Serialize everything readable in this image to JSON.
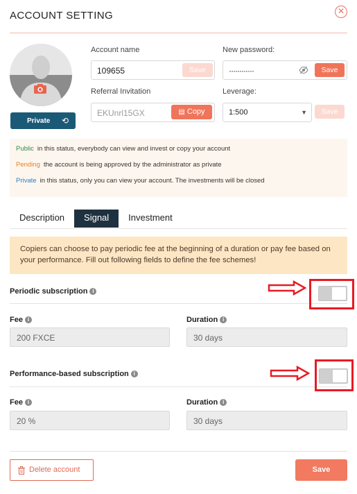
{
  "header": {
    "title": "ACCOUNT SETTING"
  },
  "profile": {
    "privacy_button": "Private"
  },
  "account_name": {
    "label": "Account name",
    "value": "109655",
    "save_label": "Save"
  },
  "new_password": {
    "label": "New password:",
    "value": "············",
    "save_label": "Save"
  },
  "referral": {
    "label": "Referral Invitation",
    "value": "EKUnrl15GX",
    "copy_label": "Copy"
  },
  "leverage": {
    "label": "Leverage:",
    "value": "1:500",
    "save_label": "Save"
  },
  "legend": [
    {
      "key": "Public",
      "text": "in this status, everybody can view and invest or copy your account"
    },
    {
      "key": "Pending",
      "text": "the account is being approved by the administrator as private"
    },
    {
      "key": "Private",
      "text": "in this status, only you can view your account. The investments will be closed"
    }
  ],
  "tabs": [
    "Description",
    "Signal",
    "Investment"
  ],
  "notice": "Copiers can choose to pay periodic fee at the beginning of a duration or pay fee based on your performance. Fill out following fields to define the fee schemes!",
  "periodic": {
    "title": "Periodic subscription",
    "fee_label": "Fee",
    "fee_value": "200 FXCE",
    "duration_label": "Duration",
    "duration_value": "30 days"
  },
  "performance": {
    "title": "Performance-based subscription",
    "fee_label": "Fee",
    "fee_value": "20 %",
    "duration_label": "Duration",
    "duration_value": "30 days"
  },
  "footer": {
    "delete_label": "Delete account",
    "save_label": "Save"
  },
  "colors": {
    "accent": "#f17a60",
    "private_button": "#1b5a76",
    "highlight": "#e81a24",
    "notice_bg": "#fce6c4"
  }
}
